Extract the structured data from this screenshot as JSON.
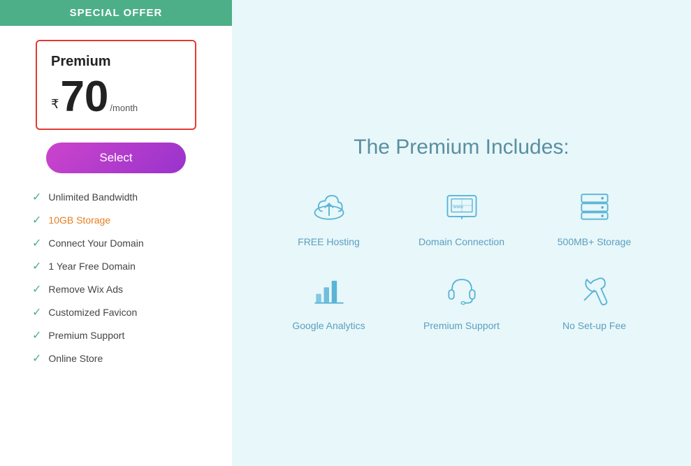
{
  "left": {
    "banner": "SPECIAL OFFER",
    "plan": {
      "name": "Premium",
      "currency": "₹",
      "amount": "70",
      "period": "/month"
    },
    "select_btn": "Select",
    "features": [
      {
        "text": "Unlimited Bandwidth",
        "highlight": false
      },
      {
        "text": "10GB Storage",
        "highlight": true
      },
      {
        "text": "Connect Your Domain",
        "highlight": false
      },
      {
        "text": "1 Year Free Domain",
        "highlight": false
      },
      {
        "text": "Remove Wix Ads",
        "highlight": false
      },
      {
        "text": "Customized Favicon",
        "highlight": false
      },
      {
        "text": "Premium Support",
        "highlight": false
      },
      {
        "text": "Online Store",
        "highlight": false
      }
    ]
  },
  "right": {
    "title": "The Premium Includes:",
    "rows": [
      [
        {
          "label": "FREE Hosting",
          "icon": "cloud-upload"
        },
        {
          "label": "Domain Connection",
          "icon": "globe"
        },
        {
          "label": "500MB+ Storage",
          "icon": "storage"
        }
      ],
      [
        {
          "label": "Google Analytics",
          "icon": "analytics"
        },
        {
          "label": "Premium Support",
          "icon": "headset"
        },
        {
          "label": "No Set-up Fee",
          "icon": "wrench"
        }
      ]
    ]
  }
}
